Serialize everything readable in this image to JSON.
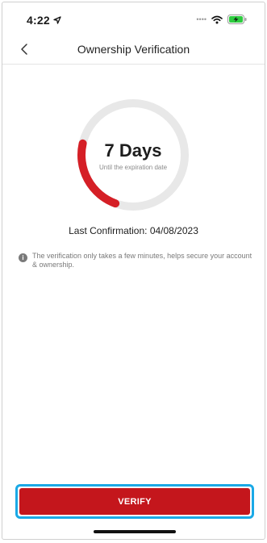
{
  "status_bar": {
    "time": "4:22",
    "location_icon": "location-arrow-icon",
    "signal_icon": "signal-dots-icon",
    "wifi_icon": "wifi-icon",
    "battery_icon": "battery-charging-icon"
  },
  "header": {
    "back_icon": "chevron-left-icon",
    "title": "Ownership Verification"
  },
  "gauge": {
    "days": "7 Days",
    "caption": "Until the expiration date",
    "progress_fraction": 0.23,
    "track_color": "#e8e8e8",
    "progress_color": "#d51f26"
  },
  "last_confirmation": "Last Confirmation: 04/08/2023",
  "info": {
    "icon": "info-icon",
    "text": "The verification only takes a few minutes, helps secure your account & ownership."
  },
  "verify_button": {
    "label": "VERIFY",
    "color": "#c4161c",
    "highlight_color": "#1aa9e6"
  }
}
